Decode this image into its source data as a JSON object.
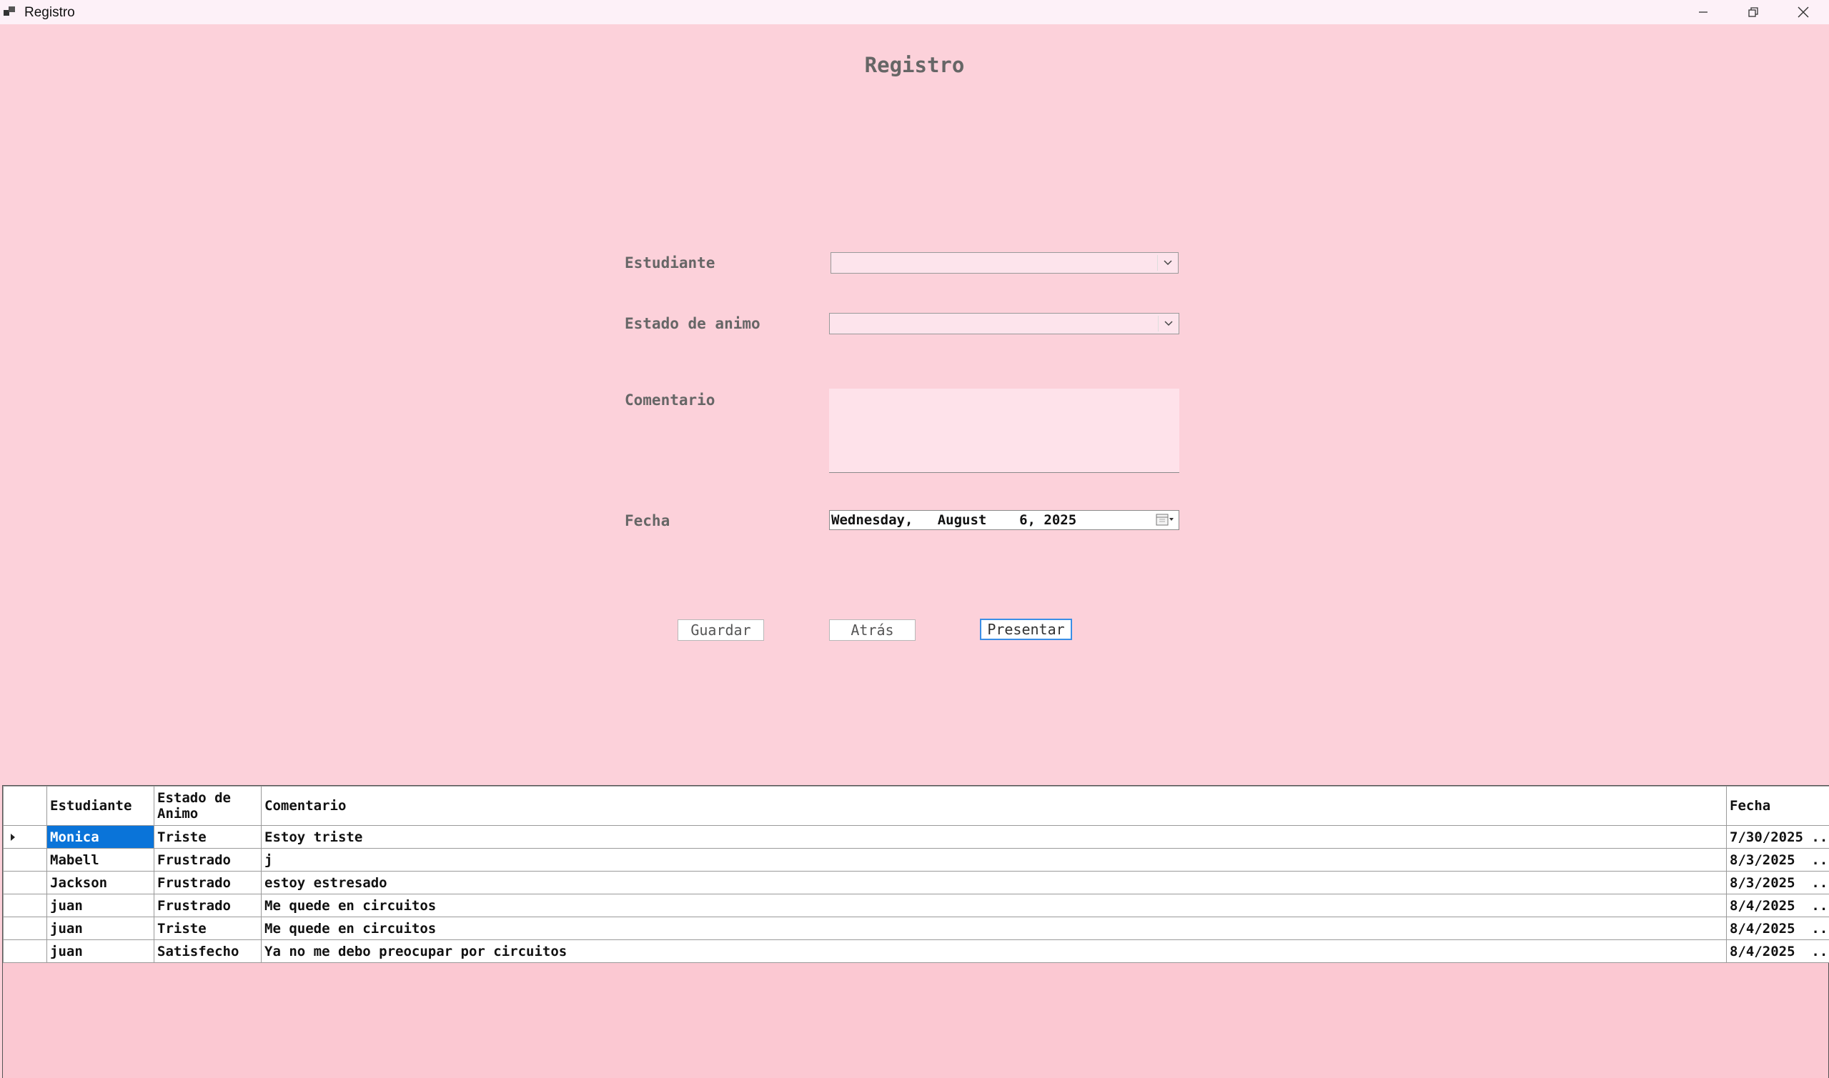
{
  "window": {
    "title": "Registro"
  },
  "heading": "Registro",
  "form": {
    "estudiante_label": "Estudiante",
    "estudiante_value": "",
    "estado_label": "Estado de animo",
    "estado_value": "",
    "comentario_label": "Comentario",
    "comentario_value": "",
    "fecha_label": "Fecha",
    "fecha_value": "Wednesday,   August    6, 2025"
  },
  "buttons": {
    "guardar": "Guardar",
    "atras": "Atrás",
    "presentar": "Presentar"
  },
  "grid": {
    "columns": [
      "Estudiante",
      "Estado de Animo",
      "Comentario",
      "Fecha"
    ],
    "rows": [
      {
        "estudiante": "Monica",
        "estado": "Triste",
        "comentario": "Estoy triste",
        "fecha": "7/30/2025 ..."
      },
      {
        "estudiante": "Mabell",
        "estado": "Frustrado",
        "comentario": "j",
        "fecha": "8/3/2025  ..."
      },
      {
        "estudiante": "Jackson",
        "estado": "Frustrado",
        "comentario": "estoy estresado",
        "fecha": "8/3/2025  ..."
      },
      {
        "estudiante": "juan",
        "estado": "Frustrado",
        "comentario": "Me quede en circuitos",
        "fecha": "8/4/2025  ..."
      },
      {
        "estudiante": "juan",
        "estado": "Triste",
        "comentario": "Me quede en circuitos",
        "fecha": "8/4/2025  ..."
      },
      {
        "estudiante": "juan",
        "estado": "Satisfecho",
        "comentario": "Ya no me debo preocupar por circuitos",
        "fecha": "8/4/2025  ..."
      }
    ]
  }
}
